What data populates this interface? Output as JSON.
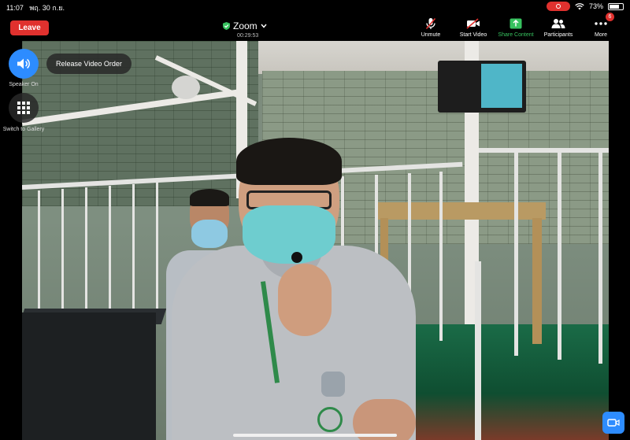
{
  "status_bar": {
    "time": "11:07",
    "date": "พฤ. 30 ก.ย.",
    "battery": "73%",
    "battery_level": 0.73
  },
  "meeting": {
    "leave_label": "Leave",
    "title": "Zoom",
    "timer": "00:29:53"
  },
  "toolbar": {
    "items": [
      {
        "label": "Unmute"
      },
      {
        "label": "Start Video"
      },
      {
        "label": "Share Content"
      },
      {
        "label": "Participants"
      },
      {
        "label": "More",
        "badge": "6"
      }
    ]
  },
  "side_controls": {
    "speaker_label": "Speaker On",
    "gallery_label": "Switch to Gallery"
  },
  "video": {
    "release_label": "Release Video Order"
  },
  "colors": {
    "leave_red": "#e0312e",
    "share_green": "#37c25f",
    "speaker_blue": "#2d8cff",
    "camera_blue": "#2d8cff"
  }
}
